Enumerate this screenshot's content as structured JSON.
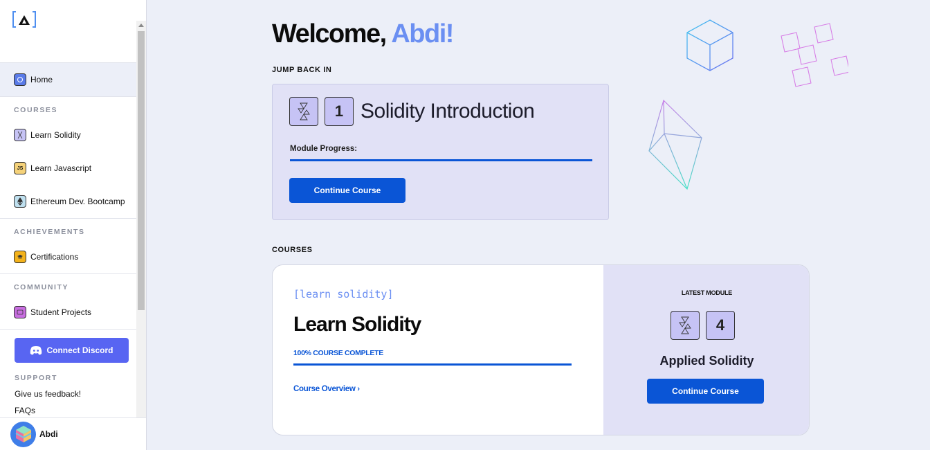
{
  "user": {
    "name": "Abdi"
  },
  "sidebar": {
    "items": [
      {
        "label": "Home",
        "icon": "home-icon"
      },
      {
        "label": "Learn Solidity",
        "icon": "solidity-icon"
      },
      {
        "label": "Learn Javascript",
        "icon": "javascript-icon"
      },
      {
        "label": "Ethereum Dev. Bootcamp",
        "icon": "ethereum-icon"
      },
      {
        "label": "Certifications",
        "icon": "certificate-icon"
      },
      {
        "label": "Student Projects",
        "icon": "folder-icon"
      }
    ],
    "sections": {
      "courses": "COURSES",
      "achievements": "ACHIEVEMENTS",
      "community": "COMMUNITY",
      "support": "SUPPORT"
    },
    "discord_label": "Connect Discord",
    "support_links": [
      "Give us feedback!",
      "FAQs"
    ]
  },
  "welcome": {
    "prefix": "Welcome,",
    "name": "Abdi!"
  },
  "jump_back": {
    "section_label": "JUMP BACK IN",
    "module_number": "1",
    "title": "Solidity Introduction",
    "progress_label": "Module Progress:",
    "progress": 1.0,
    "cta": "Continue Course"
  },
  "courses": {
    "section_label": "COURSES",
    "tag": "[learn solidity]",
    "title": "Learn Solidity",
    "complete_text": "100% COURSE COMPLETE",
    "progress": 1.0,
    "overview_link": "Course Overview",
    "latest_label": "LATEST MODULE",
    "latest_number": "4",
    "latest_title": "Applied Solidity",
    "cta": "Continue Course"
  },
  "colors": {
    "primary": "#0a55d6",
    "accent": "#6b8ff2",
    "discord": "#5865f2",
    "card_bg": "#e1e1f6"
  }
}
